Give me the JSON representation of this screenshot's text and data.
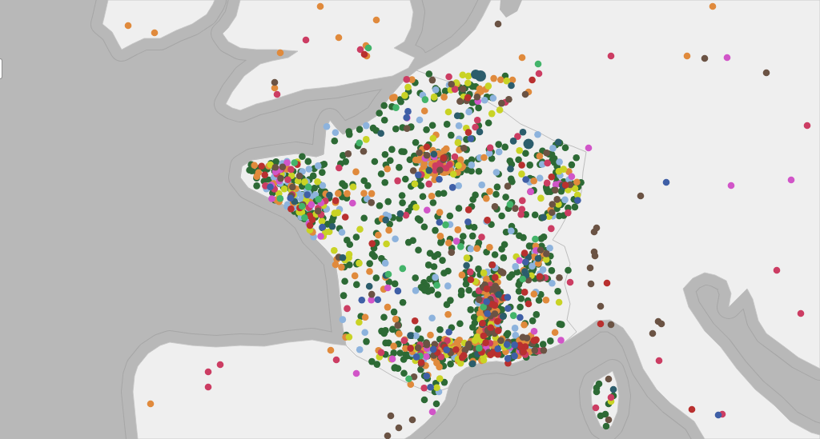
{
  "map": {
    "marker_series": [
      {
        "color": "#2d6a35"
      },
      {
        "color": "#8db3dd"
      },
      {
        "color": "#e08a3c"
      },
      {
        "color": "#c9d325"
      },
      {
        "color": "#cc3d63"
      },
      {
        "color": "#d155c8"
      },
      {
        "color": "#6b5344"
      },
      {
        "color": "#2c5d6c"
      },
      {
        "color": "#b9302f"
      },
      {
        "color": "#43b46a"
      },
      {
        "color": "#3f5fa6"
      }
    ]
  }
}
